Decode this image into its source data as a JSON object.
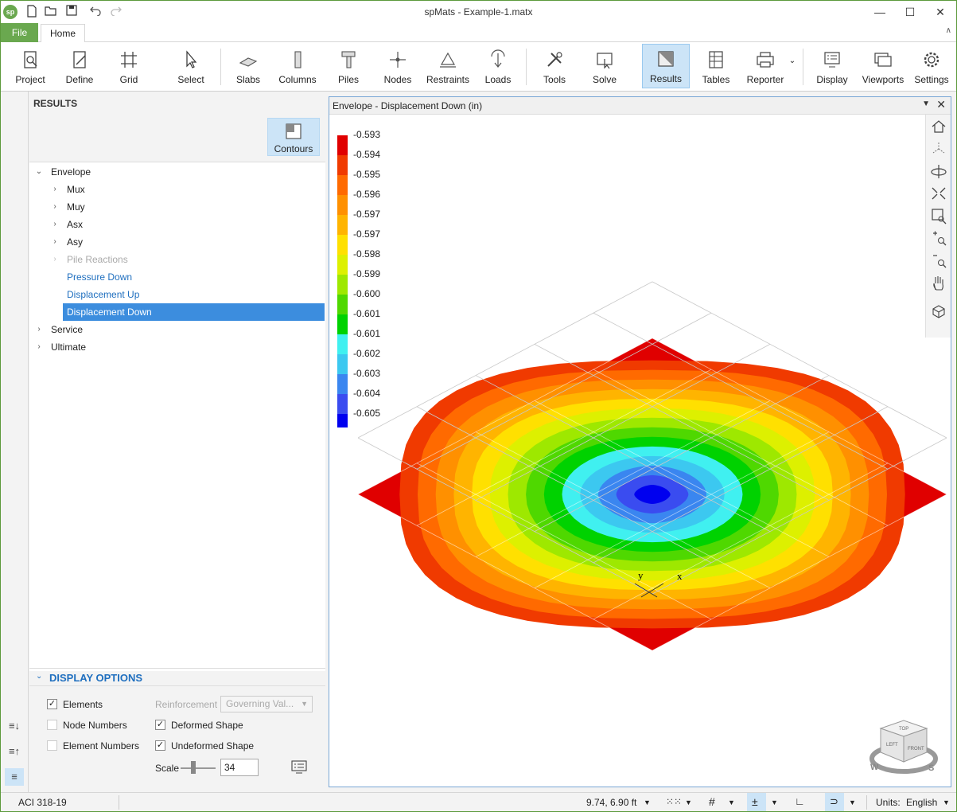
{
  "window": {
    "title": "spMats - Example-1.matx",
    "logo_text": "sp",
    "minimize": "—",
    "maximize": "☐",
    "close": "✕"
  },
  "quick_access": {
    "new_icon": "new-file-icon",
    "open_icon": "open-folder-icon",
    "save_icon": "save-icon",
    "undo_icon": "undo-icon",
    "redo_icon": "redo-icon"
  },
  "tabs": {
    "file": "File",
    "home": "Home"
  },
  "ribbon": {
    "buttons": [
      {
        "label": "Project"
      },
      {
        "label": "Define"
      },
      {
        "label": "Grid"
      },
      {
        "label": "Select"
      },
      {
        "label": "Slabs"
      },
      {
        "label": "Columns"
      },
      {
        "label": "Piles"
      },
      {
        "label": "Nodes"
      },
      {
        "label": "Restraints"
      },
      {
        "label": "Loads"
      },
      {
        "label": "Tools"
      },
      {
        "label": "Solve"
      },
      {
        "label": "Results"
      },
      {
        "label": "Tables"
      },
      {
        "label": "Reporter"
      },
      {
        "label": "Display"
      },
      {
        "label": "Viewports"
      },
      {
        "label": "Settings"
      }
    ]
  },
  "results_panel": {
    "header": "RESULTS",
    "contours_label": "Contours",
    "tree": {
      "envelope": "Envelope",
      "mux": "Mux",
      "muy": "Muy",
      "asx": "Asx",
      "asy": "Asy",
      "pile_reactions": "Pile Reactions",
      "pressure_down": "Pressure Down",
      "displacement_up": "Displacement Up",
      "displacement_down": "Displacement Down",
      "service": "Service",
      "ultimate": "Ultimate"
    }
  },
  "display_options": {
    "header": "DISPLAY OPTIONS",
    "elements": "Elements",
    "node_numbers": "Node Numbers",
    "element_numbers": "Element Numbers",
    "deformed_shape": "Deformed Shape",
    "undeformed_shape": "Undeformed Shape",
    "reinforcement_label": "Reinforcement",
    "reinforcement_value": "Governing Val...",
    "scale_label": "Scale",
    "scale_value": "34",
    "check": "✓"
  },
  "viewport": {
    "title": "Envelope - Displacement Down (in)",
    "axis_y": "y",
    "axis_x": "x",
    "legend": [
      {
        "value": "-0.593",
        "color": "#e00000"
      },
      {
        "value": "-0.594",
        "color": "#f03a00"
      },
      {
        "value": "-0.595",
        "color": "#ff6a00"
      },
      {
        "value": "-0.596",
        "color": "#ff9000"
      },
      {
        "value": "-0.597",
        "color": "#ffb400"
      },
      {
        "value": "-0.597",
        "color": "#ffe000"
      },
      {
        "value": "-0.598",
        "color": "#ddf000"
      },
      {
        "value": "-0.599",
        "color": "#9ee800"
      },
      {
        "value": "-0.600",
        "color": "#4fd800"
      },
      {
        "value": "-0.601",
        "color": "#00d200"
      },
      {
        "value": "-0.601",
        "color": "#40f0f0"
      },
      {
        "value": "-0.602",
        "color": "#3cc8f0"
      },
      {
        "value": "-0.603",
        "color": "#3a86f0"
      },
      {
        "value": "-0.604",
        "color": "#3a4cf0"
      },
      {
        "value": "-0.605",
        "color": "#0000ef"
      }
    ],
    "cube_labels": {
      "top": "TOP",
      "front": "FRONT",
      "left": "LEFT",
      "w": "W",
      "s": "S"
    }
  },
  "status_bar": {
    "code": "ACI 318-19",
    "coordinates": "9.74, 6.90 ft",
    "units_label": "Units:",
    "units_value": "English"
  }
}
